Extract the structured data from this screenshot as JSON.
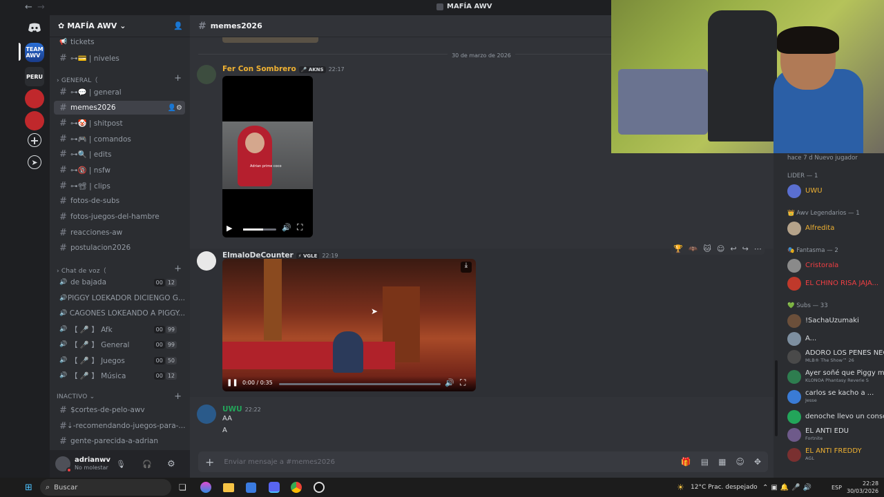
{
  "window": {
    "title": "MAFÍA AWV",
    "back": "←",
    "forward": "→"
  },
  "server": {
    "name": "MAFÍA AWV",
    "chevron": "⌄"
  },
  "channels": [
    {
      "name": "tickets",
      "type": "text-icon"
    },
    {
      "name": "⊶💳 | niveles",
      "type": "text"
    },
    {
      "name": "⊶💬 | general",
      "type": "text"
    },
    {
      "name": "memes2026",
      "type": "text",
      "selected": true
    },
    {
      "name": "⊶🤡 | shitpost",
      "type": "text"
    },
    {
      "name": "⊶🎮 | comandos",
      "type": "text"
    },
    {
      "name": "⊶🔍 | edits",
      "type": "text"
    },
    {
      "name": "⊶🔞 | nsfw",
      "type": "text"
    },
    {
      "name": "⊶📽 | clips",
      "type": "text"
    },
    {
      "name": "fotos-de-subs",
      "type": "text"
    },
    {
      "name": "fotos-juegos-del-hambre",
      "type": "text"
    },
    {
      "name": "reacciones-aw",
      "type": "text"
    },
    {
      "name": "postulacion2026",
      "type": "text"
    }
  ],
  "categories": {
    "general": "GENERAL（",
    "voice": "Chat de voz（",
    "inactive": "INACTIVO"
  },
  "voice_channels": [
    {
      "name": "de bajada",
      "c1": "00",
      "c2": "12"
    },
    {
      "name": "PIGGY LOEKADOR DICIENGO G...",
      "c1": "",
      "c2": ""
    },
    {
      "name": "CAGONES LOKEANDO A PIGGY...",
      "c1": "",
      "c2": ""
    },
    {
      "name": "【 🎤 】 Afk",
      "c1": "00",
      "c2": "99"
    },
    {
      "name": "【 🎤 】 General",
      "c1": "00",
      "c2": "99"
    },
    {
      "name": "【 🎤 】 Juegos",
      "c1": "00",
      "c2": "50"
    },
    {
      "name": "【 🎤 】 Música",
      "c1": "00",
      "c2": "12"
    }
  ],
  "inactive_channels": [
    {
      "name": "$cortes-de-pelo-awv"
    },
    {
      "name": "⇣-recomendando-juegos-para-..."
    },
    {
      "name": "gente-parecida-a-adrian"
    }
  ],
  "user": {
    "name": "adrianwv",
    "status": "No molestar"
  },
  "chat": {
    "channel": "memes2026",
    "date_divider": "30 de marzo de 2026",
    "messages": [
      {
        "author": "Fer Con Sombrero",
        "tag": "🎤 AKNS",
        "time": "22:17",
        "color": "#f0b232",
        "video_caption": "Adrian prime coco"
      },
      {
        "author": "ElmaloDeCounter",
        "tag": "⚡ VGLE",
        "time": "22:19",
        "color": "#dbdee1",
        "video_time": "0:00 / 0:35",
        "progress": 0.0
      },
      {
        "author": "UWU",
        "tag": "",
        "time": "22:22",
        "color": "#23a55a",
        "lines": [
          "AA",
          "A"
        ]
      }
    ],
    "input_placeholder": "Enviar mensaje a #memes2026"
  },
  "members": {
    "top": "hace 7 d   Nuevo jugador",
    "groups": [
      {
        "header": "LIDER — 1",
        "items": [
          {
            "name": "UWU",
            "color": "#f0b232"
          }
        ]
      },
      {
        "header": "👑 Awv Legendarios — 1",
        "items": [
          {
            "name": "Alfredita",
            "color": "#f0b232"
          }
        ]
      },
      {
        "header": "🎭 Fantasma — 2",
        "items": [
          {
            "name": "Cristorala",
            "color": "#f23f43"
          },
          {
            "name": "EL CHINO RISA JAJA...",
            "color": "#f23f43"
          }
        ]
      },
      {
        "header": "💚 Subs — 33",
        "items": [
          {
            "name": "!SachaUzumaki",
            "color": "#dbdee1"
          },
          {
            "name": "A...",
            "color": "#dbdee1"
          },
          {
            "name": "ADORO LOS PENES NEG",
            "color": "#dbdee1",
            "sub": "MLB® The Show™ 26"
          },
          {
            "name": "Ayer soñé que Piggy m m",
            "color": "#dbdee1",
            "sub": "KLONOA Phantasy Reverie S"
          },
          {
            "name": "carlos se kacho a ...",
            "color": "#dbdee1",
            "sub": "Jesse"
          },
          {
            "name": "denoche llevo un consol",
            "color": "#dbdee1"
          },
          {
            "name": "EL ANTI EDU",
            "color": "#dbdee1",
            "sub": "Fortnite"
          },
          {
            "name": "EL ANTI FREDDY",
            "color": "#f0b232",
            "sub": "AGL"
          }
        ]
      }
    ]
  },
  "taskbar": {
    "search": "Buscar",
    "weather": "12°C  Prac. despejado",
    "lang": "ESP",
    "time": "22:28",
    "date": "30/03/2026"
  },
  "colors": {
    "accent": "#5865f2",
    "online": "#23a55a",
    "dnd": "#f23f43"
  }
}
